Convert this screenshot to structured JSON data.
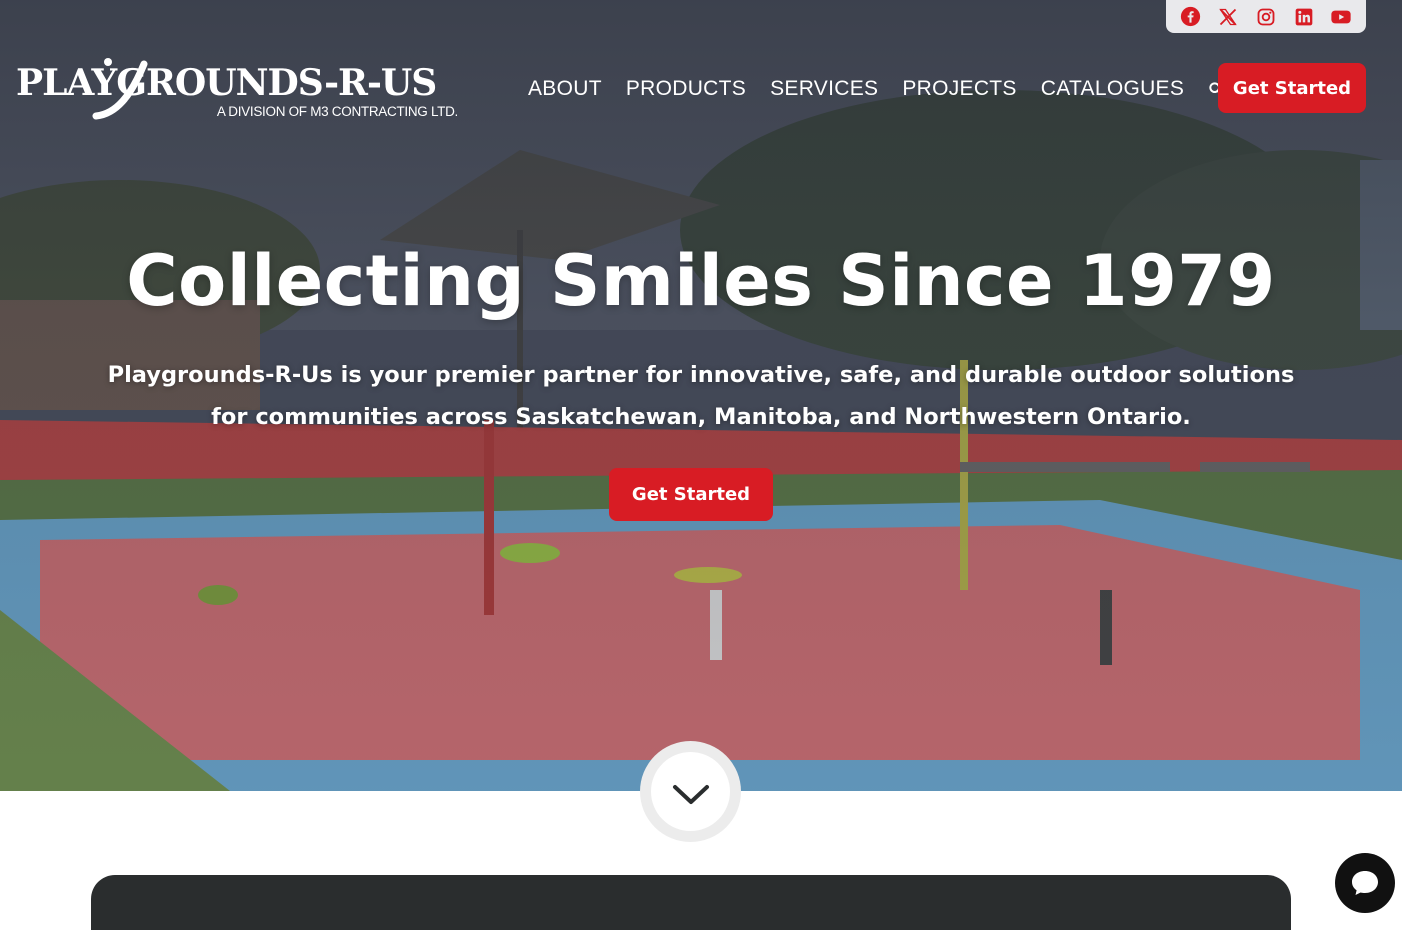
{
  "brand": {
    "logo_text": "PLAYGROUNDS-R-US",
    "tagline": "A DIVISION OF M3 CONTRACTING LTD."
  },
  "social": {
    "icons": [
      "facebook-icon",
      "x-twitter-icon",
      "instagram-icon",
      "linkedin-icon",
      "youtube-icon"
    ],
    "color": "#d81c24"
  },
  "nav": {
    "items": [
      {
        "label": "ABOUT"
      },
      {
        "label": "PRODUCTS"
      },
      {
        "label": "SERVICES"
      },
      {
        "label": "PROJECTS"
      },
      {
        "label": "CATALOGUES"
      }
    ],
    "search_icon": "search-icon",
    "cta_label": "Get Started"
  },
  "hero": {
    "title": "Collecting Smiles Since 1979",
    "subtitle": "Playgrounds-R-Us is your premier partner for innovative, safe, and durable outdoor solutions for communities across Saskatchewan, Manitoba, and Northwestern Ontario.",
    "cta_label": "Get Started",
    "scroll_icon": "chevron-down-icon"
  },
  "chat": {
    "icon": "chat-icon"
  },
  "colors": {
    "accent": "#d81c24",
    "dark_card": "#2a2d2e",
    "overlay": "#282c36"
  }
}
